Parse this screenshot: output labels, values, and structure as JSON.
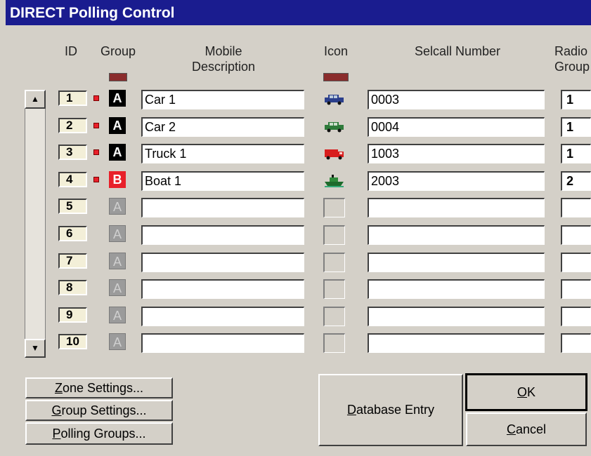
{
  "window": {
    "title": "DIRECT Polling Control"
  },
  "columns": {
    "id": "ID",
    "group": "Group",
    "desc_line1": "Mobile",
    "desc_line2": "Description",
    "icon": "Icon",
    "selcall": "Selcall Number",
    "radio_line1": "Radio",
    "radio_line2": "Group"
  },
  "rows": [
    {
      "id": "1",
      "group": "A",
      "group_state": "on",
      "description": "Car 1",
      "icon": "car-blue-icon",
      "selcall": "0003",
      "radio_group": "1"
    },
    {
      "id": "2",
      "group": "A",
      "group_state": "on",
      "description": "Car 2",
      "icon": "car-green-icon",
      "selcall": "0004",
      "radio_group": "1"
    },
    {
      "id": "3",
      "group": "A",
      "group_state": "on",
      "description": "Truck 1",
      "icon": "truck-red-icon",
      "selcall": "1003",
      "radio_group": "1"
    },
    {
      "id": "4",
      "group": "B",
      "group_state": "red",
      "description": "Boat 1",
      "icon": "boat-green-icon",
      "selcall": "2003",
      "radio_group": "2"
    },
    {
      "id": "5",
      "group": "A",
      "group_state": "off",
      "description": "",
      "icon": "",
      "selcall": "",
      "radio_group": ""
    },
    {
      "id": "6",
      "group": "A",
      "group_state": "off",
      "description": "",
      "icon": "",
      "selcall": "",
      "radio_group": ""
    },
    {
      "id": "7",
      "group": "A",
      "group_state": "off",
      "description": "",
      "icon": "",
      "selcall": "",
      "radio_group": ""
    },
    {
      "id": "8",
      "group": "A",
      "group_state": "off",
      "description": "",
      "icon": "",
      "selcall": "",
      "radio_group": ""
    },
    {
      "id": "9",
      "group": "A",
      "group_state": "off",
      "description": "",
      "icon": "",
      "selcall": "",
      "radio_group": ""
    },
    {
      "id": "10",
      "group": "A",
      "group_state": "off",
      "description": "",
      "icon": "",
      "selcall": "",
      "radio_group": ""
    }
  ],
  "buttons": {
    "zone_mn": "Z",
    "zone_rest": "one Settings...",
    "group_mn": "G",
    "group_rest": "roup Settings...",
    "polling_mn": "P",
    "polling_rest": "olling Groups...",
    "db_mn": "D",
    "db_rest": "atabase Entry",
    "ok_mn": "O",
    "ok_rest": "K",
    "cancel_mn": "C",
    "cancel_rest": "ancel"
  },
  "colors": {
    "title_bg": "#1a1c8f",
    "active_dot": "#e8202a",
    "group_b": "#e8202a",
    "color_bar": "#8a2c2c"
  }
}
